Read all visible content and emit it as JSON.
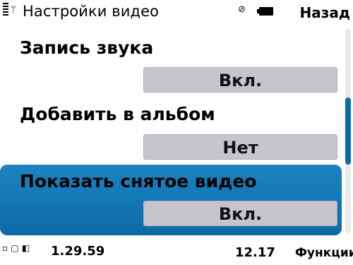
{
  "status": {
    "title": "Настройки видео",
    "back_label": "Назад",
    "antenna_icon": "antenna-icon",
    "notify_icon": "notification-icon",
    "battery_icon": "battery-icon"
  },
  "settings": [
    {
      "label": "Запись звука",
      "value": "Вкл."
    },
    {
      "label": "Добавить в альбом",
      "value": "Нет"
    },
    {
      "label": "Показать снятое видео",
      "value": "Вкл."
    }
  ],
  "bottom": {
    "time": "1.29.59",
    "date": "12.17",
    "functions_label": "Функции",
    "icons_text": "▫ ▢ ◧"
  },
  "colors": {
    "highlight": "#1378b6",
    "value_box": "#c8c4cc",
    "scroll_thumb": "#0f6cab"
  }
}
